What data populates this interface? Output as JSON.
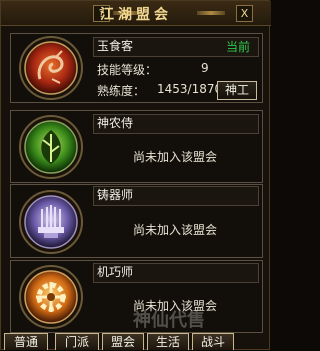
{
  "window": {
    "title": "江湖盟会",
    "help_label": "?",
    "close_label": "X"
  },
  "guilds": [
    {
      "name": "玉食客",
      "status": "当前",
      "skill_label": "技能等级：",
      "skill_value": "9",
      "proficiency_label": "熟练度：",
      "proficiency_value": "1453/1870",
      "button_label": "神工",
      "icon": "dragon-emblem-icon",
      "color": "#c83a1a"
    },
    {
      "name": "神农侍",
      "join_text": "尚未加入该盟会",
      "icon": "leaf-emblem-icon",
      "color": "#4a9a2a"
    },
    {
      "name": "铸器师",
      "join_text": "尚未加入该盟会",
      "icon": "forge-emblem-icon",
      "color": "#8a70c8"
    },
    {
      "name": "机巧师",
      "join_text": "尚未加入该盟会",
      "icon": "gear-emblem-icon",
      "color": "#e08a20"
    }
  ],
  "tabs": [
    "普通",
    "门派",
    "盟会",
    "生活",
    "战斗"
  ],
  "watermark": "神仙代售"
}
